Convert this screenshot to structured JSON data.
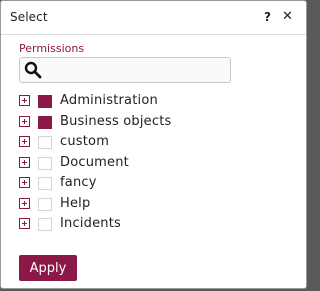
{
  "dialog": {
    "title": "Select",
    "help_label": "?",
    "close_label": "✕"
  },
  "permissions": {
    "label": "Permissions",
    "search": {
      "value": "",
      "placeholder": ""
    },
    "items": [
      {
        "label": "Administration",
        "checked": true
      },
      {
        "label": "Business objects",
        "checked": true
      },
      {
        "label": "custom",
        "checked": false
      },
      {
        "label": "Document",
        "checked": false
      },
      {
        "label": "fancy",
        "checked": false
      },
      {
        "label": "Help",
        "checked": false
      },
      {
        "label": "Incidents",
        "checked": false
      }
    ]
  },
  "footer": {
    "apply_label": "Apply"
  },
  "colors": {
    "accent": "#8b1846"
  }
}
